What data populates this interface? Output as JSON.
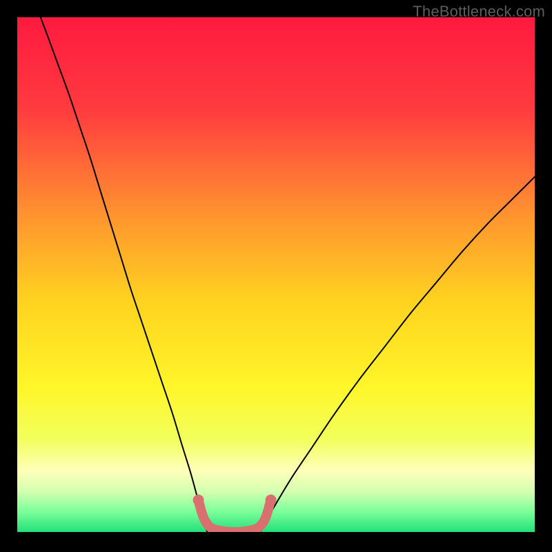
{
  "watermark": "TheBottleneck.com",
  "chart_data": {
    "type": "line",
    "title": "",
    "xlabel": "",
    "ylabel": "",
    "xlim": [
      0,
      1
    ],
    "ylim": [
      0,
      1
    ],
    "background_gradient": {
      "stops": [
        {
          "offset": 0.0,
          "color": "#ff1a3f"
        },
        {
          "offset": 0.18,
          "color": "#ff3b3f"
        },
        {
          "offset": 0.4,
          "color": "#ff9a2e"
        },
        {
          "offset": 0.55,
          "color": "#ffd21f"
        },
        {
          "offset": 0.72,
          "color": "#fff62a"
        },
        {
          "offset": 0.82,
          "color": "#f2ff5c"
        },
        {
          "offset": 0.88,
          "color": "#ffffb8"
        },
        {
          "offset": 0.92,
          "color": "#d6ffb0"
        },
        {
          "offset": 0.96,
          "color": "#7dff9a"
        },
        {
          "offset": 1.0,
          "color": "#22e07a"
        }
      ]
    },
    "series": [
      {
        "name": "left-curve",
        "color": "#000000",
        "width": 2,
        "points": [
          {
            "x": 0.045,
            "y": 1.0
          },
          {
            "x": 0.06,
            "y": 0.96
          },
          {
            "x": 0.08,
            "y": 0.905
          },
          {
            "x": 0.1,
            "y": 0.85
          },
          {
            "x": 0.12,
            "y": 0.79
          },
          {
            "x": 0.14,
            "y": 0.73
          },
          {
            "x": 0.16,
            "y": 0.665
          },
          {
            "x": 0.18,
            "y": 0.6
          },
          {
            "x": 0.2,
            "y": 0.535
          },
          {
            "x": 0.22,
            "y": 0.47
          },
          {
            "x": 0.24,
            "y": 0.41
          },
          {
            "x": 0.26,
            "y": 0.35
          },
          {
            "x": 0.28,
            "y": 0.29
          },
          {
            "x": 0.3,
            "y": 0.23
          },
          {
            "x": 0.318,
            "y": 0.17
          },
          {
            "x": 0.335,
            "y": 0.115
          },
          {
            "x": 0.35,
            "y": 0.06
          },
          {
            "x": 0.36,
            "y": 0.025
          },
          {
            "x": 0.367,
            "y": 0.0
          }
        ]
      },
      {
        "name": "right-curve",
        "color": "#000000",
        "width": 2,
        "points": [
          {
            "x": 0.47,
            "y": 0.0
          },
          {
            "x": 0.483,
            "y": 0.025
          },
          {
            "x": 0.5,
            "y": 0.055
          },
          {
            "x": 0.53,
            "y": 0.105
          },
          {
            "x": 0.57,
            "y": 0.165
          },
          {
            "x": 0.61,
            "y": 0.225
          },
          {
            "x": 0.66,
            "y": 0.295
          },
          {
            "x": 0.71,
            "y": 0.36
          },
          {
            "x": 0.76,
            "y": 0.425
          },
          {
            "x": 0.81,
            "y": 0.485
          },
          {
            "x": 0.86,
            "y": 0.545
          },
          {
            "x": 0.91,
            "y": 0.6
          },
          {
            "x": 0.96,
            "y": 0.65
          },
          {
            "x": 1.0,
            "y": 0.69
          }
        ]
      },
      {
        "name": "valley-marker",
        "color": "#d87070",
        "width": 14,
        "cap": "round",
        "points": [
          {
            "x": 0.35,
            "y": 0.062
          },
          {
            "x": 0.36,
            "y": 0.028
          },
          {
            "x": 0.372,
            "y": 0.01
          },
          {
            "x": 0.39,
            "y": 0.003
          },
          {
            "x": 0.42,
            "y": 0.0
          },
          {
            "x": 0.45,
            "y": 0.003
          },
          {
            "x": 0.468,
            "y": 0.01
          },
          {
            "x": 0.48,
            "y": 0.028
          },
          {
            "x": 0.49,
            "y": 0.062
          }
        ]
      }
    ]
  }
}
